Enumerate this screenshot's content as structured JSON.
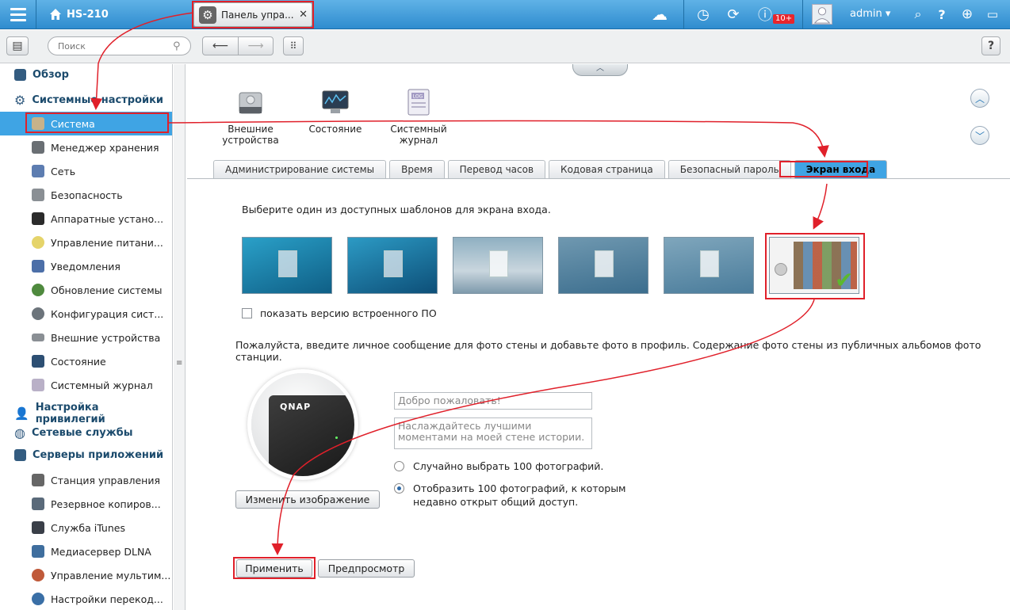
{
  "topbar": {
    "device_name": "HS-210",
    "active_tab": "Панель упра...",
    "notification_badge": "10+",
    "user": "admin"
  },
  "search": {
    "placeholder": "Поиск"
  },
  "sidebar": {
    "groups": [
      {
        "label": "Обзор",
        "icon": "overview-icon"
      },
      {
        "label": "Системные настройки",
        "icon": "gear-icon"
      },
      {
        "label": "Настройка привилегий",
        "icon": "user-icon"
      },
      {
        "label": "Сетевые службы",
        "icon": "globe-icon"
      },
      {
        "label": "Серверы приложений",
        "icon": "inbox-icon"
      }
    ],
    "items": [
      {
        "label": "Система",
        "icon": "system-icon",
        "color": "#c7b28a"
      },
      {
        "label": "Менеджер хранения",
        "icon": "storage-icon",
        "color": "#6a6f74"
      },
      {
        "label": "Сеть",
        "icon": "network-icon",
        "color": "#5d7db1"
      },
      {
        "label": "Безопасность",
        "icon": "lock-icon",
        "color": "#8a8f94"
      },
      {
        "label": "Аппаратные устано...",
        "icon": "hardware-icon",
        "color": "#2b2b2b"
      },
      {
        "label": "Управление питани...",
        "icon": "bulb-icon",
        "color": "#e5d46a"
      },
      {
        "label": "Уведомления",
        "icon": "notify-icon",
        "color": "#4c6fa8"
      },
      {
        "label": "Обновление системы",
        "icon": "update-icon",
        "color": "#4f8a3e"
      },
      {
        "label": "Конфигурация сист...",
        "icon": "config-icon",
        "color": "#6c747b"
      },
      {
        "label": "Внешние устройства",
        "icon": "external-icon",
        "color": "#8a8f94"
      },
      {
        "label": "Состояние",
        "icon": "monitor-icon",
        "color": "#2d4f73"
      },
      {
        "label": "Системный журнал",
        "icon": "log-icon",
        "color": "#b9b0c7"
      },
      {
        "label": "Станция управления",
        "icon": "station-icon",
        "color": "#666"
      },
      {
        "label": "Резервное копиров...",
        "icon": "backup-icon",
        "color": "#5a6a7a"
      },
      {
        "label": "Служба iTunes",
        "icon": "itunes-icon",
        "color": "#3a3f48"
      },
      {
        "label": "Медиасервер DLNA",
        "icon": "dlna-icon",
        "color": "#3f6e9e"
      },
      {
        "label": "Управление мультим...",
        "icon": "multimedia-icon",
        "color": "#c05a3a"
      },
      {
        "label": "Настройки перекод...",
        "icon": "transcode-icon",
        "color": "#3a6fa6"
      }
    ]
  },
  "modules": [
    {
      "label": "Внешние устройства",
      "icon": "external-device-icon"
    },
    {
      "label": "Состояние",
      "icon": "status-monitor-icon"
    },
    {
      "label": "Системный журнал",
      "icon": "system-log-icon"
    }
  ],
  "log_icon_text": "LOG",
  "tabs": [
    "Администрирование системы",
    "Время",
    "Перевод часов",
    "Кодовая страница",
    "Безопасный пароль",
    "Экран входа"
  ],
  "login_screen": {
    "prompt": "Выберите один из доступных шаблонов для экрана входа.",
    "show_firmware_label": "показать версию встроенного ПО",
    "description": "Пожалуйста, введите личное сообщение для фото стены и добавьте фото в профиль. Содержание фото стены из публичных альбомов фото станции.",
    "photo_brand": "QNAP",
    "change_image_button": "Изменить изображение",
    "title_value": "Добро пожаловать!",
    "message_value": "Наслаждайтесь лучшими моментами на моей стене истории.",
    "radio_random": "Случайно выбрать 100 фотографий.",
    "radio_recent": "Отобразить 100 фотографий, к которым недавно открыт общий доступ.",
    "apply_button": "Применить",
    "preview_button": "Предпросмотр"
  },
  "colors": {
    "accent": "#3fa4e4",
    "highlight": "#e0202a",
    "topbar": "#2f8ccf"
  }
}
